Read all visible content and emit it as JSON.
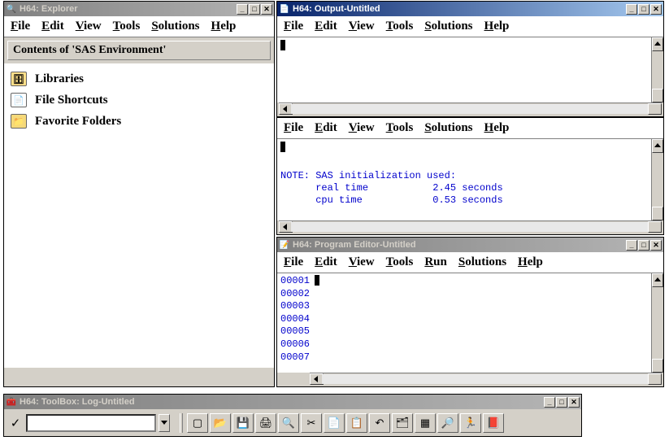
{
  "menus": {
    "standard": [
      {
        "label": "File",
        "u": "F"
      },
      {
        "label": "Edit",
        "u": "E"
      },
      {
        "label": "View",
        "u": "V"
      },
      {
        "label": "Tools",
        "u": "T"
      },
      {
        "label": "Solutions",
        "u": "S"
      },
      {
        "label": "Help",
        "u": "H"
      }
    ],
    "editor": [
      {
        "label": "File",
        "u": "F"
      },
      {
        "label": "Edit",
        "u": "E"
      },
      {
        "label": "View",
        "u": "V"
      },
      {
        "label": "Tools",
        "u": "T"
      },
      {
        "label": "Run",
        "u": "R"
      },
      {
        "label": "Solutions",
        "u": "S"
      },
      {
        "label": "Help",
        "u": "H"
      }
    ]
  },
  "explorer": {
    "title": "H64: Explorer",
    "section": "Contents of 'SAS Environment'",
    "items": [
      {
        "label": "Libraries",
        "icon": "drawer"
      },
      {
        "label": "File Shortcuts",
        "icon": "document"
      },
      {
        "label": "Favorite Folders",
        "icon": "folder"
      }
    ]
  },
  "output": {
    "title": "H64: Output-Untitled"
  },
  "log": {
    "note_line": "NOTE: SAS initialization used:",
    "real_label": "      real time",
    "real_value": "2.45 seconds",
    "cpu_label": "      cpu time",
    "cpu_value": "0.53 seconds"
  },
  "editor": {
    "title": "H64: Program Editor-Untitled",
    "lines": [
      "00001",
      "00002",
      "00003",
      "00004",
      "00005",
      "00006",
      "00007"
    ]
  },
  "toolbox": {
    "title": "H64: ToolBox: Log-Untitled",
    "buttons": [
      {
        "name": "new-icon",
        "glyph": "▢",
        "color": "#fff",
        "bg": "#fff",
        "title": "New"
      },
      {
        "name": "open-icon",
        "glyph": "📂",
        "title": "Open"
      },
      {
        "name": "save-icon",
        "glyph": "💾",
        "title": "Save"
      },
      {
        "name": "print-icon",
        "glyph": "🖨",
        "title": "Print"
      },
      {
        "name": "preview-icon",
        "glyph": "🔍",
        "title": "Preview"
      },
      {
        "name": "cut-icon",
        "glyph": "✂",
        "title": "Cut"
      },
      {
        "name": "copy-icon",
        "glyph": "📄",
        "title": "Copy"
      },
      {
        "name": "paste-icon",
        "glyph": "📋",
        "title": "Paste"
      },
      {
        "name": "undo-icon",
        "glyph": "↶",
        "title": "Undo"
      },
      {
        "name": "explorer-icon",
        "glyph": "🗂",
        "title": "Explorer"
      },
      {
        "name": "options-icon",
        "glyph": "▦",
        "title": "Options"
      },
      {
        "name": "find-icon",
        "glyph": "🔎",
        "title": "Find"
      },
      {
        "name": "run-icon",
        "glyph": "🏃",
        "title": "Run"
      },
      {
        "name": "help-icon",
        "glyph": "📕",
        "title": "Help"
      }
    ]
  },
  "win_controls": {
    "min": "_",
    "max": "□",
    "close": "✕"
  }
}
